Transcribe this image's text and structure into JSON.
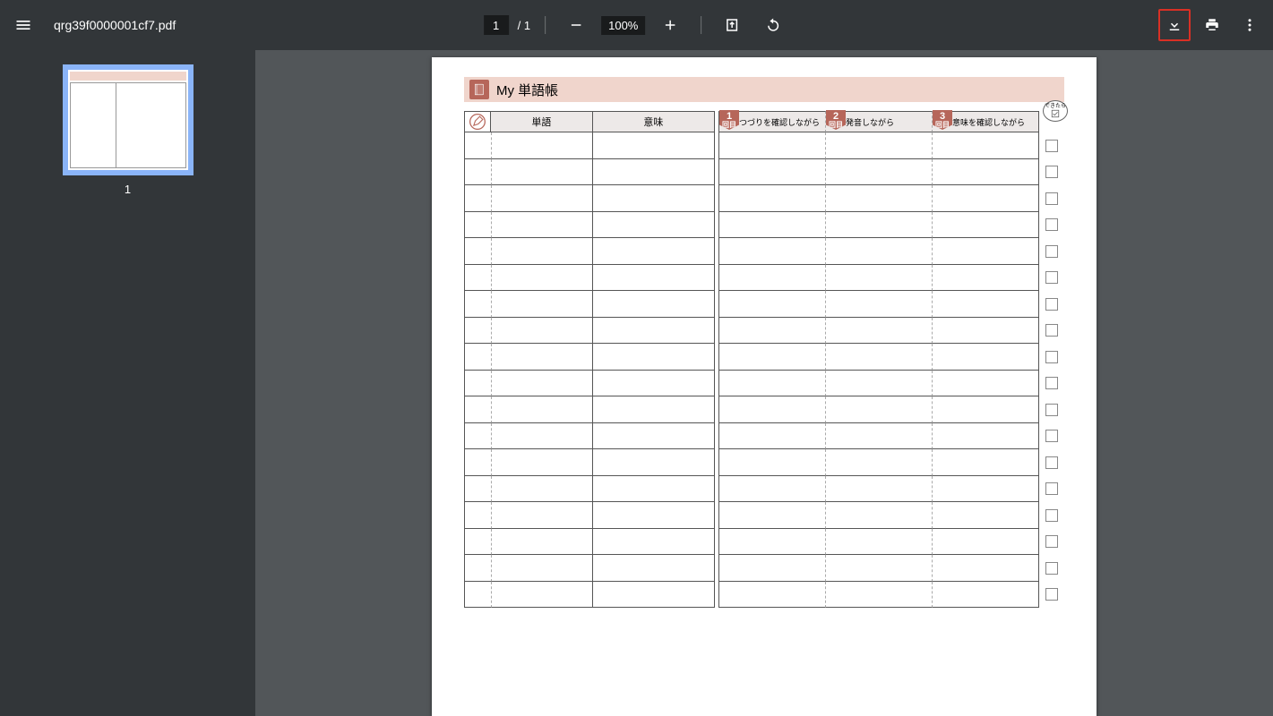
{
  "toolbar": {
    "filename": "qrg39f0000001cf7.pdf",
    "page_current": "1",
    "page_total": "/ 1",
    "zoom": "100%"
  },
  "sidebar": {
    "thumb_label": "1"
  },
  "doc": {
    "title": "My 単語帳",
    "header_word": "単語",
    "header_meaning": "意味",
    "right_headers": [
      {
        "num": "1",
        "suffix": "回目",
        "label": "つづりを確認しながら"
      },
      {
        "num": "2",
        "suffix": "回目",
        "label": "発音しながら"
      },
      {
        "num": "3",
        "suffix": "回目",
        "label": "意味を確認しながら"
      }
    ],
    "bubble_text": "できたら",
    "row_count": 18
  }
}
